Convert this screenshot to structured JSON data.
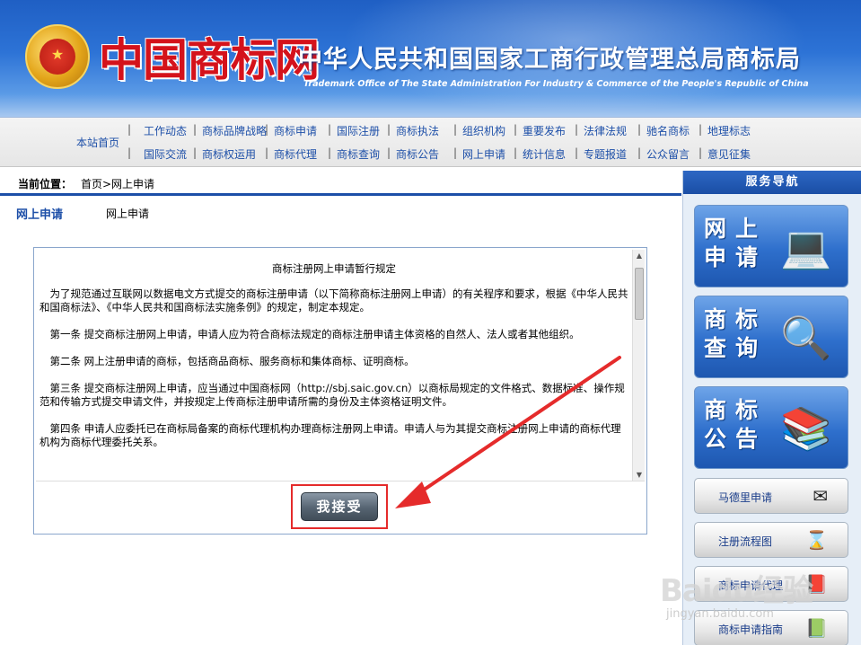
{
  "header": {
    "logo_text": "中国商标网",
    "title_cn": "中华人民共和国国家工商行政管理总局商标局",
    "title_en": "Trademark Office of The State Administration For Industry & Commerce of the People's Republic of China"
  },
  "nav": {
    "home": "本站首页",
    "row1": [
      "工作动态",
      "商标品牌战略",
      "商标申请",
      "国际注册",
      "商标执法",
      "组织机构",
      "重要发布",
      "法律法规",
      "驰名商标",
      "地理标志"
    ],
    "row2": [
      "国际交流",
      "商标权运用",
      "商标代理",
      "商标查询",
      "商标公告",
      "网上申请",
      "统计信息",
      "专题报道",
      "公众留言",
      "意见征集"
    ]
  },
  "location": {
    "label": "当前位置：",
    "path": "首页>网上申请"
  },
  "section": {
    "title": "网上申请",
    "subtitle": "网上申请"
  },
  "document": {
    "title": "商标注册网上申请暂行规定",
    "paragraphs": [
      "为了规范通过互联网以数据电文方式提交的商标注册申请（以下简称商标注册网上申请）的有关程序和要求，根据《中华人民共和国商标法》、《中华人民共和国商标法实施条例》的规定，制定本规定。",
      "第一条  提交商标注册网上申请，申请人应为符合商标法规定的商标注册申请主体资格的自然人、法人或者其他组织。",
      "第二条 网上注册申请的商标，包括商品商标、服务商标和集体商标、证明商标。",
      "第三条  提交商标注册网上申请，应当通过中国商标网（http://sbj.saic.gov.cn）以商标局规定的文件格式、数据标准、操作规范和传输方式提交申请文件，并按规定上传商标注册申请所需的身份及主体资格证明文件。",
      "第四条  申请人应委托已在商标局备案的商标代理机构办理商标注册网上申请。申请人与为其提交商标注册网上申请的商标代理机构为商标代理委托关系。"
    ],
    "accept_label": "我接受"
  },
  "sidebar": {
    "title": "服务导航",
    "big_buttons": [
      {
        "label": "网上申请",
        "icon": "laptop-globe-icon"
      },
      {
        "label": "商标查询",
        "icon": "magnifier-books-icon"
      },
      {
        "label": "商标公告",
        "icon": "books-globe-icon"
      }
    ],
    "small_buttons": [
      {
        "label": "马德里申请",
        "icon": "envelope-icon"
      },
      {
        "label": "注册流程图",
        "icon": "hourglass-icon"
      },
      {
        "label": "商标申请代理",
        "icon": "books-icon"
      },
      {
        "label": "商标申请指南",
        "icon": "book-icon"
      }
    ]
  },
  "watermark": {
    "brand": "Baidu经验",
    "url": "jingyan.baidu.com"
  },
  "colors": {
    "nav_link": "#1d4fa8",
    "annotation_red": "#e52b2b",
    "banner_blue": "#2d73d6"
  }
}
